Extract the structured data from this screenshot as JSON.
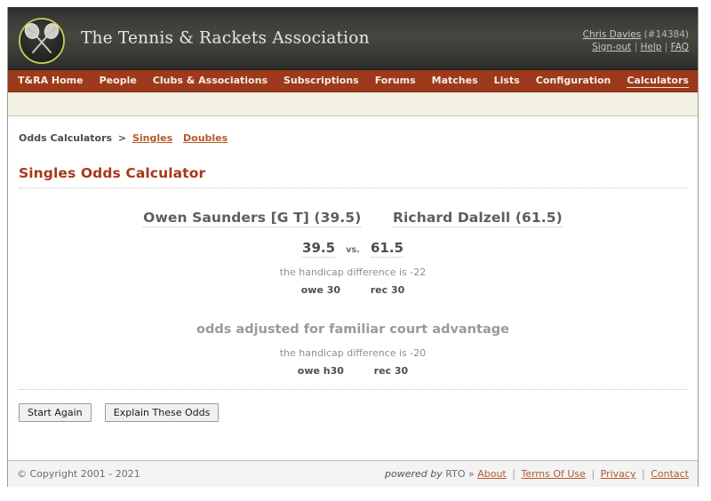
{
  "header": {
    "logo_icon": "crossed-rackets-logo",
    "site_title": "The Tennis & Rackets Association",
    "user": {
      "name": "Chris Davies",
      "id": "(#14384)",
      "signout": "Sign-out",
      "help": "Help",
      "faq": "FAQ",
      "separator": "|"
    }
  },
  "nav": {
    "items": [
      {
        "label": "T&RA Home",
        "active": false
      },
      {
        "label": "People",
        "active": false
      },
      {
        "label": "Clubs & Associations",
        "active": false
      },
      {
        "label": "Subscriptions",
        "active": false
      },
      {
        "label": "Forums",
        "active": false
      },
      {
        "label": "Matches",
        "active": false
      },
      {
        "label": "Lists",
        "active": false
      },
      {
        "label": "Configuration",
        "active": false
      },
      {
        "label": "Calculators",
        "active": true
      }
    ]
  },
  "breadcrumb": {
    "root": "Odds Calculators",
    "separator": ">",
    "links": [
      "Singles",
      "Doubles"
    ]
  },
  "page": {
    "title": "Singles Odds Calculator"
  },
  "odds": {
    "player_left": "Owen Saunders [G T] (39.5)",
    "player_right": "Richard Dalzell (61.5)",
    "score_left": "39.5",
    "vs_label": "vs.",
    "score_right": "61.5",
    "handicap_line": "the handicap difference is -22",
    "owe_label": "owe 30",
    "rec_label": "rec 30",
    "adjusted_heading": "odds adjusted for familiar court advantage",
    "adjusted_handicap_line": "the handicap difference is -20",
    "adjusted_owe_label": "owe h30",
    "adjusted_rec_label": "rec 30"
  },
  "buttons": {
    "start_again": "Start Again",
    "explain": "Explain These Odds"
  },
  "footer": {
    "copyright": "© Copyright 2001 - 2021",
    "powered_by": "powered by",
    "rto": "RTO »",
    "links": [
      "About",
      "Terms Of Use",
      "Privacy",
      "Contact"
    ],
    "separator": "|"
  },
  "colors": {
    "brand_red": "#9c3a1b",
    "title_red": "#a6381a",
    "link_orange": "#b15a2e",
    "header_dark": "#3d3c36",
    "cream": "#f2f1e1",
    "logo_ring": "#c8cc5a"
  }
}
